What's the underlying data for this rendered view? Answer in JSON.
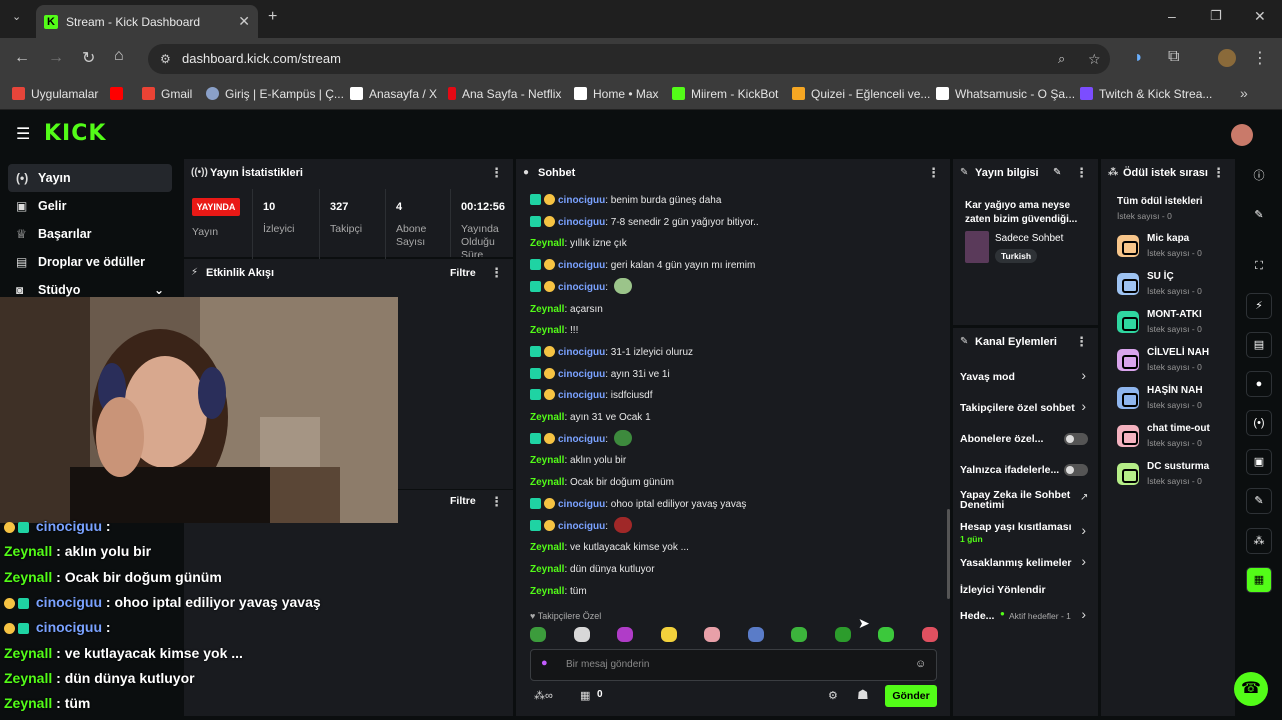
{
  "browser": {
    "tab_title": "Stream - Kick Dashboard",
    "url": "dashboard.kick.com/stream",
    "bookmarks": [
      {
        "label": "Uygulamalar",
        "color": "#e6453a"
      },
      {
        "label": "",
        "color": "#ff0000"
      },
      {
        "label": "Gmail",
        "color": "#ea4335"
      },
      {
        "label": "Giriş | E-Kampüs | Ç...",
        "color": "#8aa0c8"
      },
      {
        "label": "Anasayfa / X",
        "color": "#ffffff"
      },
      {
        "label": "Ana Sayfa - Netflix",
        "color": "#e50914"
      },
      {
        "label": "Home • Max",
        "color": "#ffffff"
      },
      {
        "label": "Miirem - KickBot",
        "color": "#53fc18"
      },
      {
        "label": "Quizei - Eğlenceli ve...",
        "color": "#f5a623"
      },
      {
        "label": "Whatsamusic - O Şa...",
        "color": "#ffffff"
      },
      {
        "label": "Twitch & Kick Strea...",
        "color": "#7c4dff"
      }
    ]
  },
  "kick": {
    "logo": "KICK"
  },
  "sidebar": {
    "items": [
      {
        "label": "Yayın",
        "icon": "broadcast-icon"
      },
      {
        "label": "Gelir",
        "icon": "money-icon"
      },
      {
        "label": "Başarılar",
        "icon": "trophy-icon"
      },
      {
        "label": "Droplar ve ödüller",
        "icon": "gift-icon"
      },
      {
        "label": "Stüdyo",
        "icon": "studio-icon"
      }
    ]
  },
  "stats": {
    "title": "Yayın İstatistikleri",
    "live_badge": "YAYINDA",
    "live_label": "Yayın",
    "items": [
      {
        "value": "10",
        "label": "İzleyici"
      },
      {
        "value": "327",
        "label": "Takipçi"
      },
      {
        "value": "4",
        "label": "Abone Sayısı"
      },
      {
        "value": "00:12:56",
        "label": "Yayında Olduğu Süre"
      }
    ]
  },
  "activity": {
    "title": "Etkinlik Akışı",
    "filter": "Filtre",
    "filter2": "Filtre"
  },
  "chat": {
    "title": "Sohbet",
    "messages": [
      {
        "user": "cinociguu",
        "text": ": benim burda güneş daha",
        "type": "c"
      },
      {
        "user": "cinociguu",
        "text": ": 7-8 senedir 2 gün yağıyor bitiyor..",
        "type": "c"
      },
      {
        "user": "Zeynall",
        "text": ": yıllık izne çık",
        "type": "z"
      },
      {
        "user": "cinociguu",
        "text": ": geri kalan 4 gün yayın mı iremim",
        "type": "c"
      },
      {
        "user": "cinociguu",
        "text": ":",
        "type": "c",
        "emote": "#9bc48a"
      },
      {
        "user": "Zeynall",
        "text": ": açarsın",
        "type": "z"
      },
      {
        "user": "Zeynall",
        "text": ": !!!",
        "type": "z"
      },
      {
        "user": "cinociguu",
        "text": ": 31-1 izleyici oluruz",
        "type": "c"
      },
      {
        "user": "cinociguu",
        "text": ": ayın 31i ve 1i",
        "type": "c"
      },
      {
        "user": "cinociguu",
        "text": ": isdfciusdf",
        "type": "c"
      },
      {
        "user": "Zeynall",
        "text": ": ayın 31 ve Ocak 1",
        "type": "z"
      },
      {
        "user": "cinociguu",
        "text": ":",
        "type": "c",
        "emote": "#3d8a3d"
      },
      {
        "user": "Zeynall",
        "text": ": aklın yolu bir",
        "type": "z"
      },
      {
        "user": "Zeynall",
        "text": ": Ocak bir doğum günüm",
        "type": "z"
      },
      {
        "user": "cinociguu",
        "text": ": ohoo iptal ediliyor yavaş yavaş",
        "type": "c"
      },
      {
        "user": "cinociguu",
        "text": ":",
        "type": "c",
        "emote": "#a02828"
      },
      {
        "user": "Zeynall",
        "text": ": ve kutlayacak kimse yok ...",
        "type": "z"
      },
      {
        "user": "Zeynall",
        "text": ": dün dünya kutluyor",
        "type": "z"
      },
      {
        "user": "Zeynall",
        "text": ": tüm",
        "type": "z"
      }
    ],
    "followers_only": "Takipçilere Özel",
    "emote_colors": [
      "#3c9c3c",
      "#d8d8d8",
      "#b03cc8",
      "#f2d13c",
      "#e8a0a8",
      "#5a7cc8",
      "#3cb43c",
      "#2c9c2c",
      "#3cc83c",
      "#e05060"
    ],
    "input_placeholder": "Bir mesaj gönderin",
    "points": "0",
    "send_label": "Gönder"
  },
  "stream_info": {
    "title": "Yayın bilgisi",
    "stream_title": "Kar yağıyo ama neyse zaten bizim güvendiği...",
    "category": "Sadece Sohbet",
    "tag": "Turkish"
  },
  "channel_actions": {
    "title": "Kanal Eylemleri",
    "items": [
      {
        "label": "Yavaş mod",
        "kind": "chevron"
      },
      {
        "label": "Takipçilere özel sohbet",
        "kind": "chevron"
      },
      {
        "label": "Abonelere özel...",
        "kind": "toggle"
      },
      {
        "label": "Yalnızca ifadelerle...",
        "kind": "toggle"
      },
      {
        "label": "Yapay Zeka ile Sohbet Denetimi",
        "kind": "link"
      },
      {
        "label": "Hesap yaşı kısıtlaması",
        "sub": "1 gün",
        "kind": "chevron"
      },
      {
        "label": "Yasaklanmış kelimeler",
        "kind": "chevron"
      },
      {
        "label": "İzleyici Yönlendir",
        "kind": "none"
      },
      {
        "label": "Hede...",
        "sub": "Aktif hedefler - 1",
        "kind": "chevron"
      }
    ]
  },
  "rewards": {
    "title": "Ödül istek sırası",
    "all_label": "Tüm ödül istekleri",
    "all_count": "İstek sayısı - 0",
    "items": [
      {
        "name": "Mic kapa",
        "count": "İstek sayısı - 0",
        "color": "#f7c58a"
      },
      {
        "name": "SU İÇ",
        "count": "İstek sayısı - 0",
        "color": "#9ec3f2"
      },
      {
        "name": "MONT-ATKI",
        "count": "İstek sayısı - 0",
        "color": "#2fd6a0"
      },
      {
        "name": "CİLVELİ NAH",
        "count": "İstek sayısı - 0",
        "color": "#d9a4ec"
      },
      {
        "name": "HAŞİN NAH",
        "count": "İstek sayısı - 0",
        "color": "#8fb6ef"
      },
      {
        "name": "chat time-out",
        "count": "İstek sayısı - 0",
        "color": "#f4b2bf"
      },
      {
        "name": "DC susturma",
        "count": "İstek sayısı - 0",
        "color": "#b6ee88"
      }
    ]
  },
  "overlay_chat": [
    {
      "user": "cinociguu",
      "text": ":",
      "type": "c"
    },
    {
      "user": "Zeynall",
      "text": ": aklın yolu bir",
      "type": "z"
    },
    {
      "user": "Zeynall",
      "text": ": Ocak bir doğum günüm",
      "type": "z"
    },
    {
      "user": "cinociguu",
      "text": ": ohoo iptal ediliyor yavaş yavaş",
      "type": "c"
    },
    {
      "user": "cinociguu",
      "text": ":",
      "type": "c"
    },
    {
      "user": "Zeynall",
      "text": ": ve kutlayacak kimse yok ...",
      "type": "z"
    },
    {
      "user": "Zeynall",
      "text": ": dün dünya kutluyor",
      "type": "z"
    },
    {
      "user": "Zeynall",
      "text": ": tüm",
      "type": "z"
    }
  ]
}
